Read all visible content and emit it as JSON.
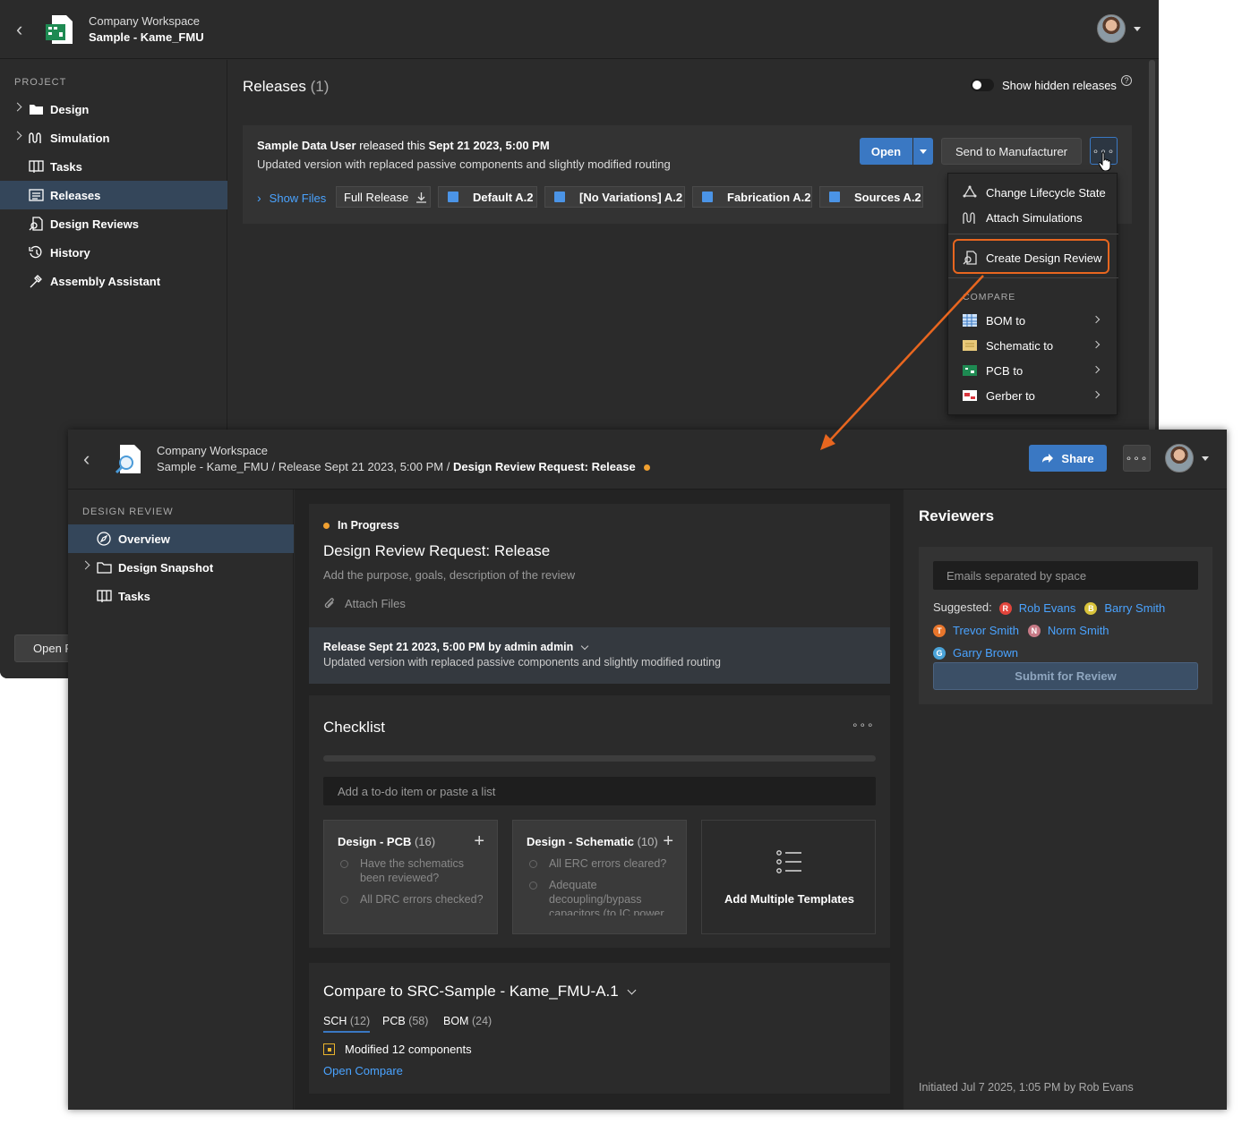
{
  "releases_window": {
    "header": {
      "workspace": "Company Workspace",
      "project": "Sample - Kame_FMU"
    },
    "sidebar": {
      "section_label": "PROJECT",
      "items": [
        {
          "label": "Design"
        },
        {
          "label": "Simulation"
        },
        {
          "label": "Tasks"
        },
        {
          "label": "Releases"
        },
        {
          "label": "Design Reviews"
        },
        {
          "label": "History"
        },
        {
          "label": "Assembly Assistant"
        }
      ],
      "open_button": "Open F"
    },
    "main": {
      "title": "Releases",
      "count": "(1)",
      "show_hidden_label": "Show hidden releases",
      "release": {
        "user": "Sample Data User",
        "released_text": "released this",
        "date": "Sept 21 2023, 5:00 PM",
        "description": "Updated version with replaced passive components and slightly modified routing",
        "open_label": "Open",
        "send_label": "Send to Manufacturer",
        "show_files": "Show Files",
        "full_release": "Full Release",
        "chips": [
          "Default A.2",
          "[No Variations] A.2",
          "Fabrication A.2",
          "Sources A.2"
        ]
      }
    },
    "menu": {
      "items": [
        "Change Lifecycle State",
        "Attach Simulations",
        "Create Design Review"
      ],
      "compare_label": "COMPARE",
      "compare_items": [
        "BOM to",
        "Schematic to",
        "PCB to",
        "Gerber to"
      ]
    }
  },
  "review_window": {
    "header": {
      "workspace": "Company Workspace",
      "path": "Sample - Kame_FMU / Release Sept 21 2023, 5:00 PM /",
      "current": "Design Review Request: Release",
      "share_label": "Share"
    },
    "sidebar": {
      "section_label": "DESIGN REVIEW",
      "items": [
        {
          "label": "Overview"
        },
        {
          "label": "Design Snapshot"
        },
        {
          "label": "Tasks"
        }
      ]
    },
    "overview": {
      "status": "In Progress",
      "title": "Design Review Request: Release",
      "purpose_placeholder": "Add the purpose, goals, description of the review",
      "attach_label": "Attach Files",
      "release_line": "Release Sept 21 2023, 5:00 PM by admin admin",
      "release_desc": "Updated version with replaced passive components and slightly modified routing"
    },
    "checklist": {
      "title": "Checklist",
      "input_placeholder": "Add a to-do item or paste a list",
      "templates": [
        {
          "name": "Design - PCB",
          "count": "(16)",
          "items": [
            "Have the schematics been reviewed?",
            "All DRC errors checked?"
          ]
        },
        {
          "name": "Design - Schematic",
          "count": "(10)",
          "items": [
            "All ERC errors cleared?",
            "Adequate decoupling/bypass capacitors (to IC power"
          ]
        }
      ],
      "add_multiple_label": "Add Multiple Templates"
    },
    "compare": {
      "title": "Compare to SRC-Sample - Kame_FMU-A.1",
      "tabs": [
        {
          "label": "SCH",
          "count": "(12)"
        },
        {
          "label": "PCB",
          "count": "(58)"
        },
        {
          "label": "BOM",
          "count": "(24)"
        }
      ],
      "modified_text": "Modified 12 components",
      "open_compare": "Open Compare"
    },
    "reviewers": {
      "title": "Reviewers",
      "email_placeholder": "Emails separated by space",
      "suggested_label": "Suggested:",
      "people": [
        {
          "initial": "R",
          "name": "Rob Evans",
          "color": "#e2453c"
        },
        {
          "initial": "B",
          "name": "Barry Smith",
          "color": "#d9c33a"
        },
        {
          "initial": "T",
          "name": "Trevor Smith",
          "color": "#e8762c"
        },
        {
          "initial": "N",
          "name": "Norm Smith",
          "color": "#c77a86"
        },
        {
          "initial": "G",
          "name": "Garry Brown",
          "color": "#4aa3d8"
        }
      ],
      "submit_label": "Submit for Review",
      "initiated": "Initiated Jul 7 2025, 1:05 PM by Rob Evans"
    }
  },
  "colors": {
    "accent": "#3a78c3",
    "highlight": "#e8661f",
    "link": "#4aa3ff",
    "status": "#f0a030"
  }
}
